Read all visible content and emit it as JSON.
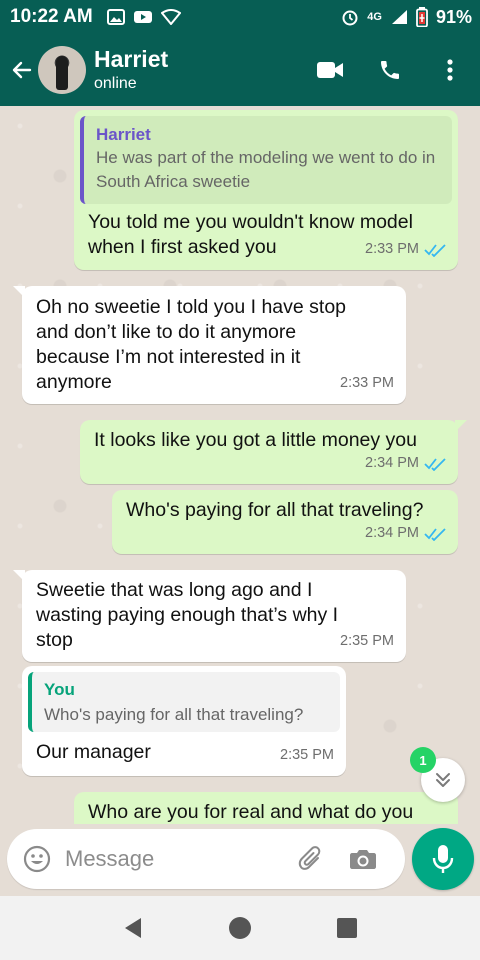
{
  "status_bar": {
    "time": "10:22 AM",
    "battery": "91%",
    "network": "4G"
  },
  "header": {
    "name": "Harriet",
    "status": "online"
  },
  "messages": [
    {
      "direction": "out",
      "quote_name": "Harriet",
      "quote_text": "He was part of the modeling we went to do in South Africa sweetie",
      "text": "You told me you wouldn't know model when I first asked you",
      "time": "2:33 PM"
    },
    {
      "direction": "in",
      "text": "Oh no sweetie I told you I have stop and don’t like to do it anymore because I’m not interested in it anymore",
      "time": "2:33 PM"
    },
    {
      "direction": "out",
      "text": "It looks like you got a little money you",
      "time": "2:34 PM"
    },
    {
      "direction": "out",
      "text": "Who's paying for all that traveling?",
      "time": "2:34 PM"
    },
    {
      "direction": "in",
      "text": "Sweetie that was long ago and I wasting paying enough that’s why I stop",
      "time": "2:35 PM"
    },
    {
      "direction": "in",
      "quote_name": "You",
      "quote_text": "Who's paying for all that traveling?",
      "text": "Our manager",
      "time": "2:35 PM"
    },
    {
      "direction": "out",
      "text": "Who are you for real and what do you"
    }
  ],
  "unread_count": "1",
  "input": {
    "placeholder": "Message"
  },
  "colors": {
    "header": "#075e54",
    "outgoing_bubble": "#dcf8c6",
    "incoming_bubble": "#ffffff",
    "quote_harriet": "#6b55c9",
    "quote_you": "#06a37a",
    "mic_button": "#00a884",
    "read_ticks": "#34b7f1"
  },
  "icons": {
    "back": "arrow-left-icon",
    "video": "video-camera-icon",
    "call": "phone-icon",
    "menu": "more-vert-icon",
    "emoji": "emoji-icon",
    "attach": "paperclip-icon",
    "camera": "camera-icon",
    "mic": "microphone-icon",
    "scroll": "chevron-double-down-icon"
  }
}
